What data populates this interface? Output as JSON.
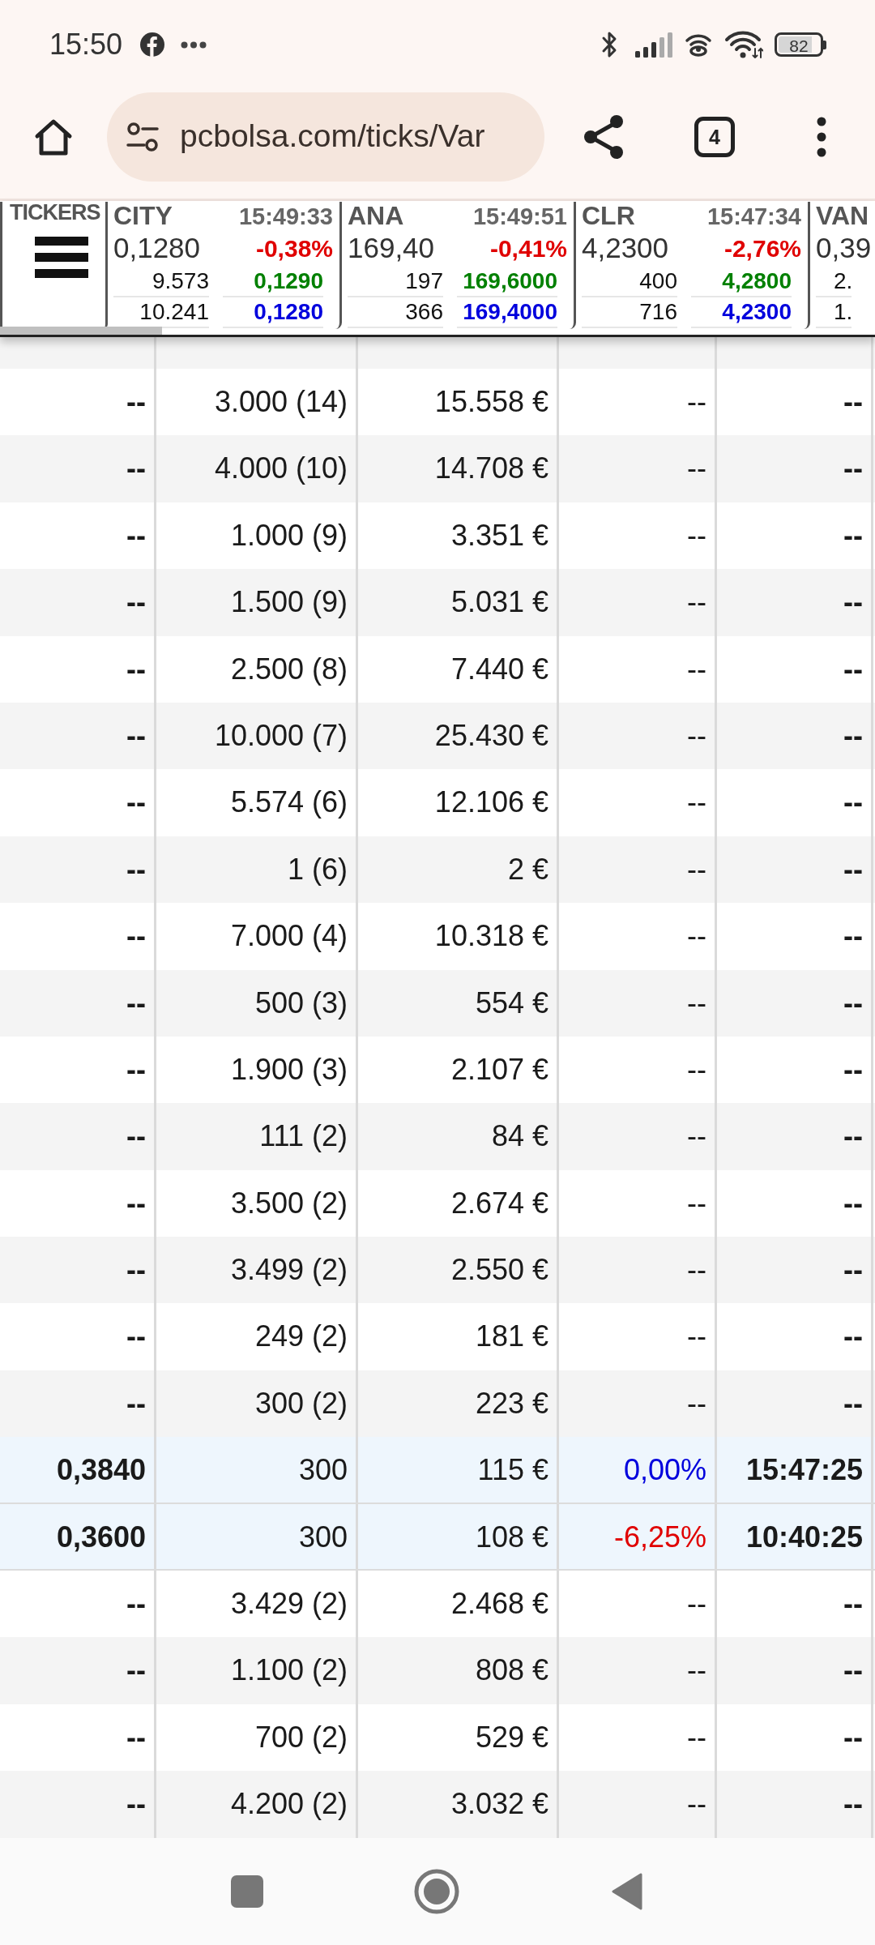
{
  "status_bar": {
    "time": "15:50",
    "battery": "82"
  },
  "browser_toolbar": {
    "url": "pcbolsa.com/ticks/Var",
    "tab_count": "4"
  },
  "ticker_strip": {
    "label": "TICKERS",
    "tickers": [
      {
        "symbol": "CITY",
        "time": "15:49:33",
        "price": "0,1280",
        "change": "-0,38%",
        "down": true,
        "depth": [
          {
            "volume": "9.573",
            "price": "0,1290",
            "color": "#008000"
          },
          {
            "volume": "10.241",
            "price": "0,1280",
            "color": "#0000dd"
          }
        ]
      },
      {
        "symbol": "ANA",
        "time": "15:49:51",
        "price": "169,40",
        "change": "-0,41%",
        "down": true,
        "depth": [
          {
            "volume": "197",
            "price": "169,6000",
            "color": "#008000"
          },
          {
            "volume": "366",
            "price": "169,4000",
            "color": "#0000dd"
          }
        ]
      },
      {
        "symbol": "CLR",
        "time": "15:47:34",
        "price": "4,2300",
        "change": "-2,76%",
        "down": true,
        "depth": [
          {
            "volume": "400",
            "price": "4,2800",
            "color": "#008000"
          },
          {
            "volume": "716",
            "price": "4,2300",
            "color": "#0000dd"
          }
        ]
      },
      {
        "symbol": "VAN",
        "price": "0,39",
        "depth": [
          {
            "volume": "2."
          },
          {
            "volume": "1."
          }
        ]
      }
    ]
  },
  "table": {
    "rows": [
      {
        "cells": [
          "--",
          "3.000 (14)",
          "15.558 €",
          "--",
          "--"
        ],
        "highlighted": false
      },
      {
        "cells": [
          "--",
          "4.000 (10)",
          "14.708 €",
          "--",
          "--"
        ],
        "highlighted": false
      },
      {
        "cells": [
          "--",
          "1.000 (9)",
          "3.351 €",
          "--",
          "--"
        ],
        "highlighted": false
      },
      {
        "cells": [
          "--",
          "1.500 (9)",
          "5.031 €",
          "--",
          "--"
        ],
        "highlighted": false
      },
      {
        "cells": [
          "--",
          "2.500 (8)",
          "7.440 €",
          "--",
          "--"
        ],
        "highlighted": false
      },
      {
        "cells": [
          "--",
          "10.000 (7)",
          "25.430 €",
          "--",
          "--"
        ],
        "highlighted": false
      },
      {
        "cells": [
          "--",
          "5.574 (6)",
          "12.106 €",
          "--",
          "--"
        ],
        "highlighted": false
      },
      {
        "cells": [
          "--",
          "1 (6)",
          "2 €",
          "--",
          "--"
        ],
        "highlighted": false
      },
      {
        "cells": [
          "--",
          "7.000 (4)",
          "10.318 €",
          "--",
          "--"
        ],
        "highlighted": false
      },
      {
        "cells": [
          "--",
          "500 (3)",
          "554 €",
          "--",
          "--"
        ],
        "highlighted": false
      },
      {
        "cells": [
          "--",
          "1.900 (3)",
          "2.107 €",
          "--",
          "--"
        ],
        "highlighted": false
      },
      {
        "cells": [
          "--",
          "111 (2)",
          "84 €",
          "--",
          "--"
        ],
        "highlighted": false
      },
      {
        "cells": [
          "--",
          "3.500 (2)",
          "2.674 €",
          "--",
          "--"
        ],
        "highlighted": false
      },
      {
        "cells": [
          "--",
          "3.499 (2)",
          "2.550 €",
          "--",
          "--"
        ],
        "highlighted": false
      },
      {
        "cells": [
          "--",
          "249 (2)",
          "181 €",
          "--",
          "--"
        ],
        "highlighted": false
      },
      {
        "cells": [
          "--",
          "300 (2)",
          "223 €",
          "--",
          "--"
        ],
        "highlighted": false
      },
      {
        "cells": [
          "0,3840",
          "300",
          "115 €",
          "0,00%",
          "15:47:25"
        ],
        "highlighted": true,
        "down": false
      },
      {
        "cells": [
          "0,3600",
          "300",
          "108 €",
          "-6,25%",
          "10:40:25"
        ],
        "highlighted": true,
        "down": true
      },
      {
        "cells": [
          "--",
          "3.429 (2)",
          "2.468 €",
          "--",
          "--"
        ],
        "highlighted": false
      },
      {
        "cells": [
          "--",
          "1.100 (2)",
          "808 €",
          "--",
          "--"
        ],
        "highlighted": false
      },
      {
        "cells": [
          "--",
          "700 (2)",
          "529 €",
          "--",
          "--"
        ],
        "highlighted": false
      },
      {
        "cells": [
          "--",
          "4.200 (2)",
          "3.032 €",
          "--",
          "--"
        ],
        "highlighted": false
      }
    ]
  }
}
